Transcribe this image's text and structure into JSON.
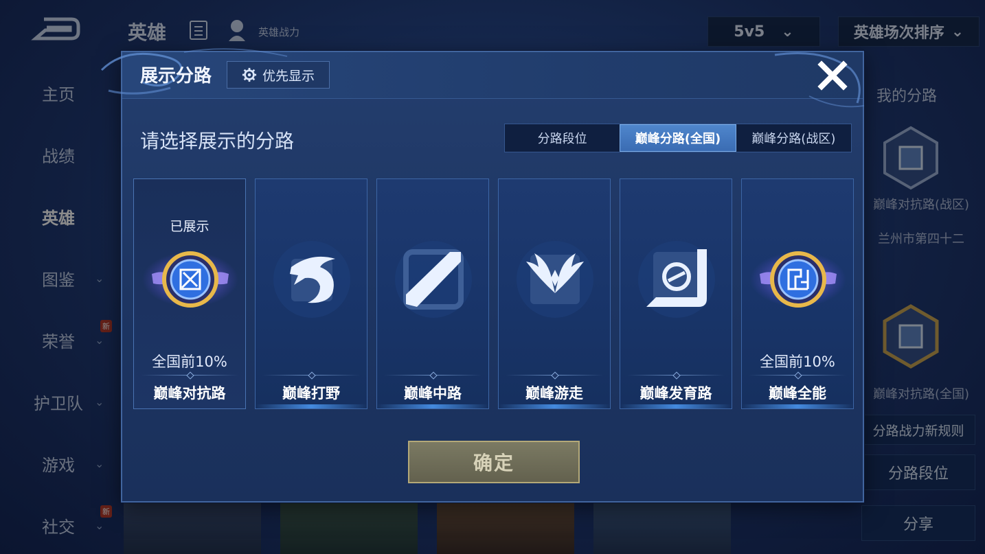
{
  "background": {
    "topbar": {
      "title": "英雄",
      "subtitle": "英雄战力",
      "mode_select": "5v5",
      "sort_select": "英雄场次排序"
    },
    "sidebar": {
      "items": [
        {
          "label": "主页"
        },
        {
          "label": "战绩"
        },
        {
          "label": "英雄"
        },
        {
          "label": "图鉴"
        },
        {
          "label": "荣誉",
          "badge": "新"
        },
        {
          "label": "护卫队"
        },
        {
          "label": "游戏"
        },
        {
          "label": "社交",
          "badge": "新"
        }
      ]
    },
    "right_panel": {
      "title": "我的分路",
      "lane1_label": "巅峰对抗路(战区)",
      "lane1_region": "兰州市第四十二",
      "lane2_label": "巅峰对抗路(全国)",
      "rules_button": "分路战力新规则",
      "rank_button": "分路段位",
      "share_button": "分享"
    }
  },
  "modal": {
    "title": "展示分路",
    "priority_button": "优先显示",
    "prompt": "请选择展示的分路",
    "tabs": [
      {
        "label": "分路段位",
        "active": false
      },
      {
        "label": "巅峰分路(全国)",
        "active": true
      },
      {
        "label": "巅峰分路(战区)",
        "active": false
      }
    ],
    "cards": [
      {
        "name": "巅峰对抗路",
        "shown_label": "已展示",
        "rank": "全国前10%",
        "icon": "clash-lane-emblem-icon"
      },
      {
        "name": "巅峰打野",
        "shown_label": "",
        "rank": "",
        "icon": "jungle-dragon-icon"
      },
      {
        "name": "巅峰中路",
        "shown_label": "",
        "rank": "",
        "icon": "mid-lane-slash-icon"
      },
      {
        "name": "巅峰游走",
        "shown_label": "",
        "rank": "",
        "icon": "roam-wings-icon"
      },
      {
        "name": "巅峰发育路",
        "shown_label": "",
        "rank": "",
        "icon": "farm-lane-icon"
      },
      {
        "name": "巅峰全能",
        "shown_label": "",
        "rank": "全国前10%",
        "icon": "all-rounder-emblem-icon"
      }
    ],
    "confirm_button": "确定"
  },
  "colors": {
    "modal_bg": "#1d3562",
    "active_tab": "#4578c0",
    "confirm_bg": "#6f6d58",
    "emblem_gold": "#e8b84a",
    "emblem_purple": "#8a6cff"
  }
}
